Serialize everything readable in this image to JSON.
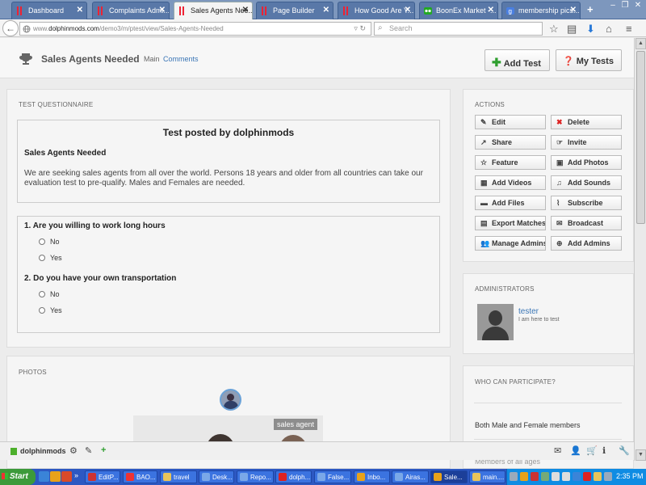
{
  "browser": {
    "tabs": [
      {
        "label": "Dashboard",
        "active": false
      },
      {
        "label": "Complaints Admi...",
        "active": false
      },
      {
        "label": "Sales Agents Nee...",
        "active": true
      },
      {
        "label": "Page Builder",
        "active": false
      },
      {
        "label": "How Good Are Y...",
        "active": false
      },
      {
        "label": "BoonEx Market -...",
        "active": false
      },
      {
        "label": "membership pics...",
        "active": false
      }
    ],
    "url_prefix": "www.",
    "url_domain": "dolphinmods.com",
    "url_path": "/demo3/m/ptest/view/Sales-Agents-Needed",
    "search_placeholder": "Search"
  },
  "page": {
    "title": "Sales Agents Needed",
    "nav_main": "Main",
    "nav_comments": "Comments",
    "add_test_label": "Add Test",
    "my_tests_label": "My Tests"
  },
  "questionnaire": {
    "header": "TEST QUESTIONNAIRE",
    "posted_by": "Test posted by dolphinmods",
    "subtitle": "Sales Agents Needed",
    "description": "We are seeking sales agents from all over the world. Persons 18 years and older from all countries can take our evaluation test to pre-qualify. Males and Females are needed.",
    "questions": [
      {
        "text": "1. Are you willing to work long hours",
        "options": [
          "No",
          "Yes"
        ]
      },
      {
        "text": "2. Do you have your own transportation",
        "options": [
          "No",
          "Yes"
        ]
      }
    ]
  },
  "actions": {
    "header": "ACTIONS",
    "buttons": [
      {
        "label": "Edit",
        "icon": "edit-icon"
      },
      {
        "label": "Delete",
        "icon": "delete-icon"
      },
      {
        "label": "Share",
        "icon": "share-icon"
      },
      {
        "label": "Invite",
        "icon": "invite-icon"
      },
      {
        "label": "Feature",
        "icon": "star-icon"
      },
      {
        "label": "Add Photos",
        "icon": "photo-icon"
      },
      {
        "label": "Add Videos",
        "icon": "video-icon"
      },
      {
        "label": "Add Sounds",
        "icon": "music-icon"
      },
      {
        "label": "Add Files",
        "icon": "file-icon"
      },
      {
        "label": "Subscribe",
        "icon": "paperclip-icon"
      },
      {
        "label": "Export Matches",
        "icon": "table-icon"
      },
      {
        "label": "Broadcast",
        "icon": "envelope-icon"
      },
      {
        "label": "Manage Admins",
        "icon": "users-icon"
      },
      {
        "label": "Add Admins",
        "icon": "add-user-icon"
      }
    ]
  },
  "administrators": {
    "header": "ADMINISTRATORS",
    "name": "tester",
    "description": "I am here to test"
  },
  "photos": {
    "header": "PHOTOS",
    "caption": "sales agent"
  },
  "participate": {
    "header": "WHO CAN PARTICIPATE?",
    "value": "Both Male and Female members",
    "partial": "Members of all ages"
  },
  "sitebar": {
    "name": "dolphinmods"
  },
  "taskbar": {
    "start_label": "Start",
    "tasks": [
      {
        "label": "EditP...",
        "active": false
      },
      {
        "label": "BAO...",
        "active": false
      },
      {
        "label": "travel",
        "active": false
      },
      {
        "label": "Desk...",
        "active": false
      },
      {
        "label": "Repo...",
        "active": false
      },
      {
        "label": "dolph...",
        "active": false
      },
      {
        "label": "False...",
        "active": false
      },
      {
        "label": "Inbo...",
        "active": false
      },
      {
        "label": "Airas...",
        "active": false
      },
      {
        "label": "Sale...",
        "active": true
      },
      {
        "label": "main....",
        "active": false
      }
    ],
    "clock": "2:35 PM"
  },
  "colors": {
    "link": "#3b76b6",
    "add_icon": "#2e9e2e",
    "delete_icon": "#dd2222",
    "taskbar": "#2d58c2",
    "tray": "#0f8ce3"
  }
}
